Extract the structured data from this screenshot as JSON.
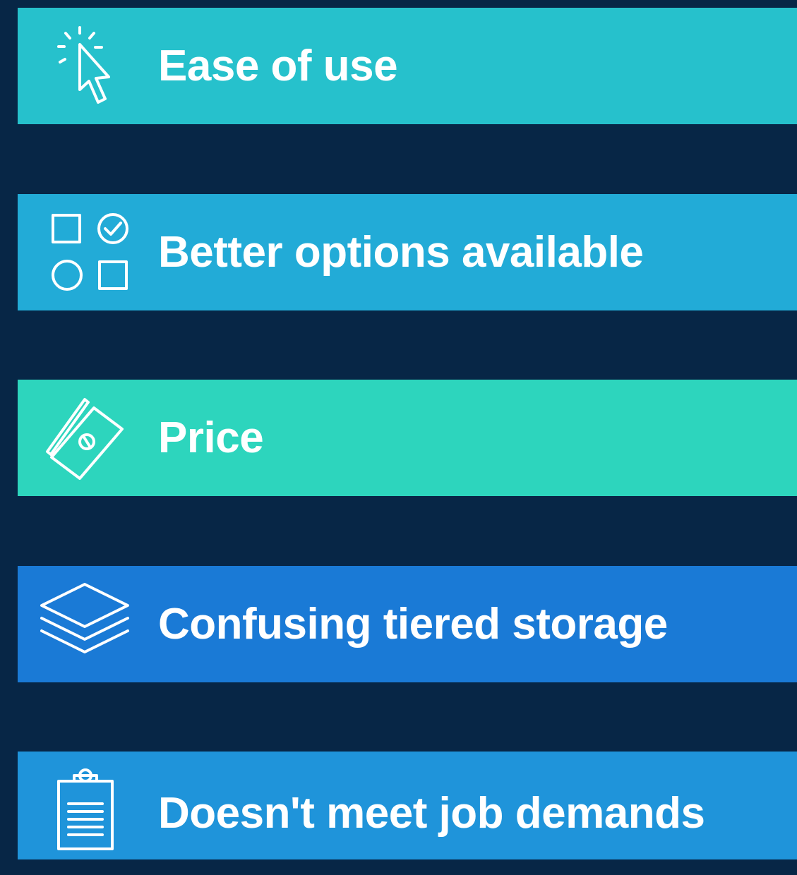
{
  "background_color": "#072646",
  "items": [
    {
      "label": "Ease of use",
      "icon": "cursor-click-icon",
      "color": "#26C1CC"
    },
    {
      "label": "Better options available",
      "icon": "options-checklist-icon",
      "color": "#22ABD7"
    },
    {
      "label": "Price",
      "icon": "money-bill-icon",
      "color": "#2DD5BD"
    },
    {
      "label": "Confusing tiered storage",
      "icon": "layers-icon",
      "color": "#1A7AD6"
    },
    {
      "label": "Doesn't meet job demands",
      "icon": "clipboard-icon",
      "color": "#1F94DA"
    }
  ]
}
